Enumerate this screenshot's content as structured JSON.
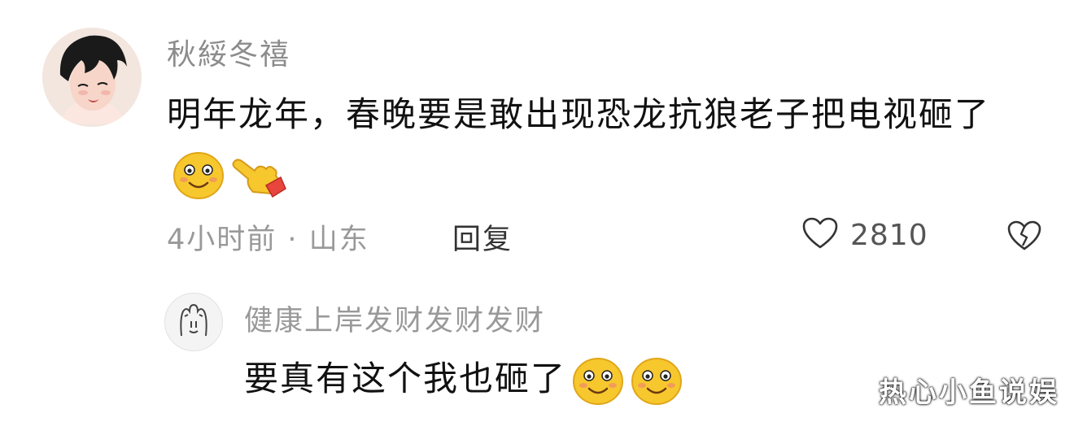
{
  "comment": {
    "username": "秋綏冬禧",
    "text": "明年龙年，春晚要是敢出现恐龙抗狼老子把电视砸了",
    "emojis": [
      "smiley-face-icon",
      "pointing-hand-icon"
    ],
    "time": "4小时前",
    "separator": "·",
    "location": "山东",
    "reply_label": "回复",
    "like_count": "2810"
  },
  "reply": {
    "username": "健康上岸发财发财发财",
    "text": "要真有这个我也砸了",
    "emojis": [
      "smiley-face-icon",
      "smiley-face-icon"
    ]
  },
  "watermark": "热心小鱼说娱",
  "colors": {
    "username": "#8c8c8c",
    "text": "#111111",
    "meta": "#999999",
    "emoji_face": "#f7c72e"
  }
}
